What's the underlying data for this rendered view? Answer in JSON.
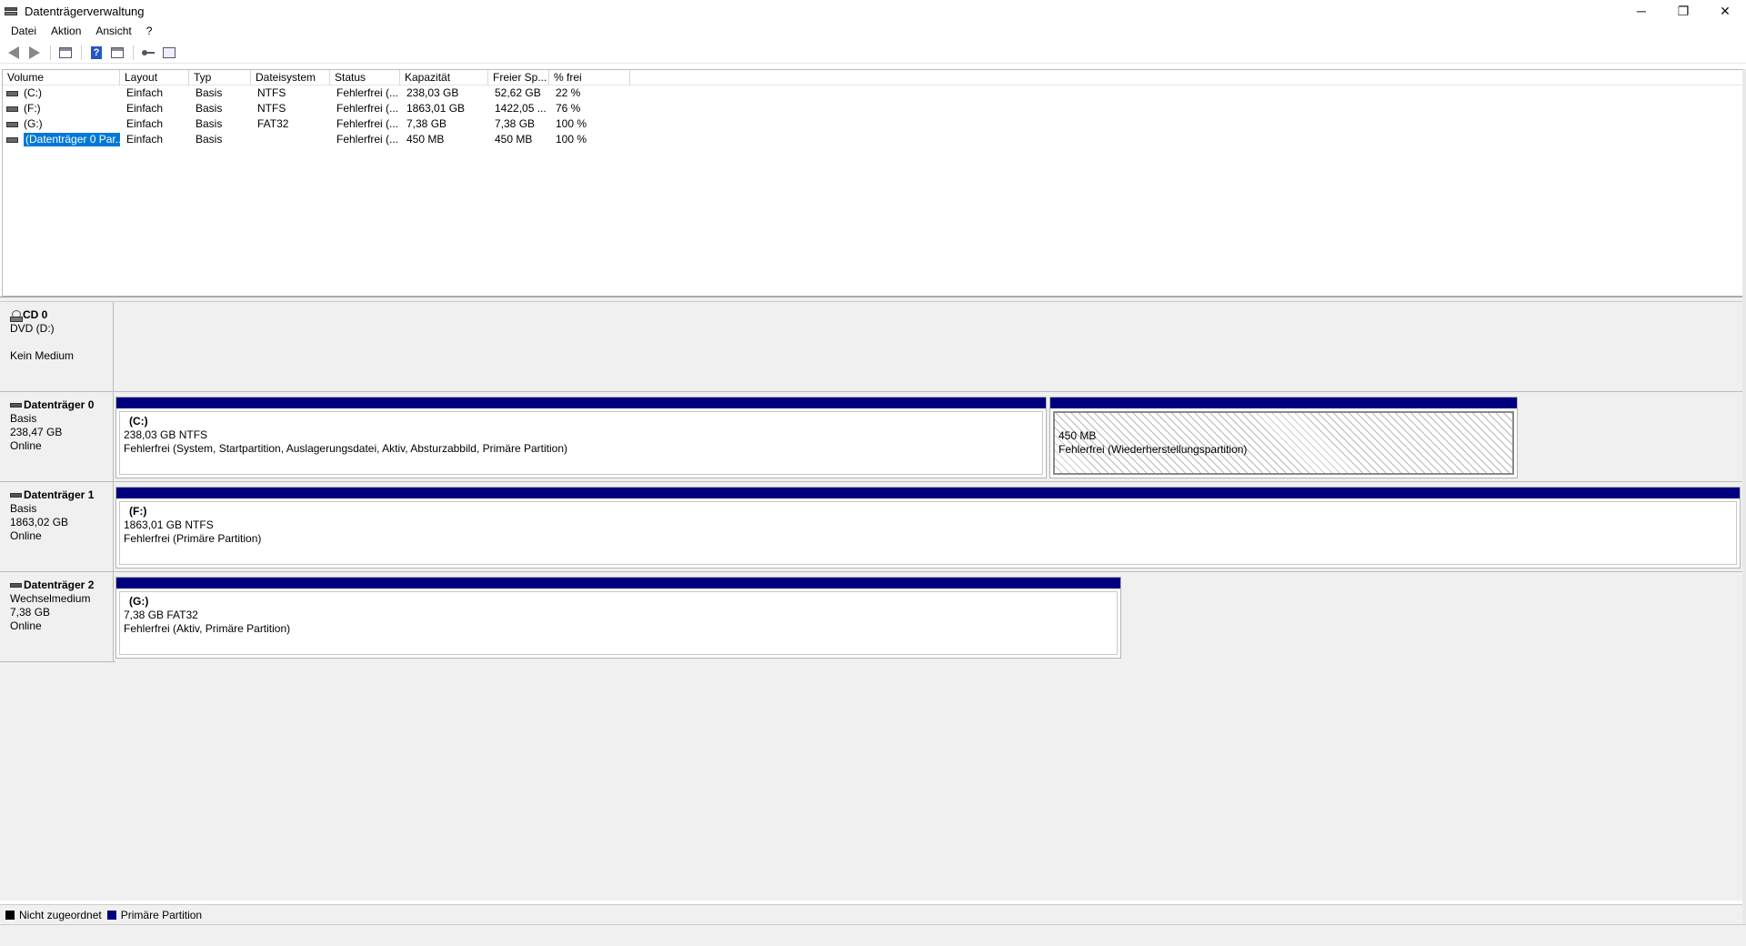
{
  "window": {
    "title": "Datenträgerverwaltung",
    "minimize": "─",
    "restore": "❐",
    "close": "✕"
  },
  "menu": [
    "Datei",
    "Aktion",
    "Ansicht",
    "?"
  ],
  "toolbar": {
    "icons": [
      "back-icon",
      "forward-icon",
      "console-tree-icon",
      "help-icon",
      "properties-icon",
      "key-icon",
      "list-icon"
    ]
  },
  "volume_list": {
    "columns": [
      "Volume",
      "Layout",
      "Typ",
      "Dateisystem",
      "Status",
      "Kapazität",
      "Freier Sp...",
      "% frei"
    ],
    "rows": [
      {
        "volume": "(C:)",
        "layout": "Einfach",
        "typ": "Basis",
        "fs": "NTFS",
        "status": "Fehlerfrei (...",
        "capacity": "238,03 GB",
        "free": "52,62 GB",
        "pct": "22 %"
      },
      {
        "volume": "(F:)",
        "layout": "Einfach",
        "typ": "Basis",
        "fs": "NTFS",
        "status": "Fehlerfrei (...",
        "capacity": "1863,01 GB",
        "free": "1422,05 ...",
        "pct": "76 %"
      },
      {
        "volume": "(G:)",
        "layout": "Einfach",
        "typ": "Basis",
        "fs": "FAT32",
        "status": "Fehlerfrei (...",
        "capacity": "7,38 GB",
        "free": "7,38 GB",
        "pct": "100 %"
      },
      {
        "volume": "(Datenträger 0 Par...",
        "layout": "Einfach",
        "typ": "Basis",
        "fs": "",
        "status": "Fehlerfrei (...",
        "capacity": "450 MB",
        "free": "450 MB",
        "pct": "100 %"
      }
    ]
  },
  "disks": {
    "cd0": {
      "name": "CD 0",
      "line1": "DVD (D:)",
      "line2": "",
      "line3": "Kein Medium"
    },
    "disk0": {
      "name": "Datenträger 0",
      "type": "Basis",
      "size": "238,47 GB",
      "state": "Online",
      "partitions": [
        {
          "name": "(C:)",
          "size": "238,03 GB NTFS",
          "status": "Fehlerfrei (System, Startpartition, Auslagerungsdatei, Aktiv, Absturzabbild, Primäre Partition)"
        },
        {
          "name": "",
          "size": "450 MB",
          "status": "Fehlerfrei (Wiederherstellungspartition)"
        }
      ]
    },
    "disk1": {
      "name": "Datenträger 1",
      "type": "Basis",
      "size": "1863,02 GB",
      "state": "Online",
      "partitions": [
        {
          "name": "(F:)",
          "size": "1863,01 GB NTFS",
          "status": "Fehlerfrei (Primäre Partition)"
        }
      ]
    },
    "disk2": {
      "name": "Datenträger 2",
      "type": "Wechselmedium",
      "size": "7,38 GB",
      "state": "Online",
      "partitions": [
        {
          "name": "(G:)",
          "size": "7,38 GB FAT32",
          "status": "Fehlerfrei (Aktiv, Primäre Partition)"
        }
      ]
    }
  },
  "legend": [
    {
      "label": "Nicht zugeordnet",
      "color": "#000000"
    },
    {
      "label": "Primäre Partition",
      "color": "#00007f"
    }
  ],
  "colors": {
    "primary_partition": "#00007f",
    "selection": "#0078d7"
  }
}
